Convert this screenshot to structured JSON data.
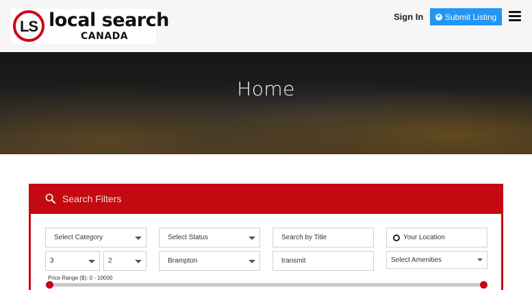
{
  "header": {
    "logo_mark": "LS",
    "logo_main": "local search",
    "logo_sub": "CANADA",
    "signin_label": "Sign In",
    "submit_label": "Submit Listing"
  },
  "hero": {
    "title": "Home"
  },
  "filters": {
    "title": "Search Filters",
    "category_placeholder": "Select Category",
    "status_placeholder": "Select Status",
    "title_search_placeholder": "Search by Title",
    "location_placeholder": "Your Location",
    "bedrooms_value": "3",
    "bathrooms_value": "2",
    "city_value": "Brampton",
    "keyword_value": "transmit",
    "amenities_placeholder": "Select Amenities",
    "price_label": "Price Range ($): 0 - 10000",
    "price_min": 0,
    "price_max": 10000
  },
  "colors": {
    "brand_red": "#c40a10",
    "button_blue": "#2196f3"
  }
}
